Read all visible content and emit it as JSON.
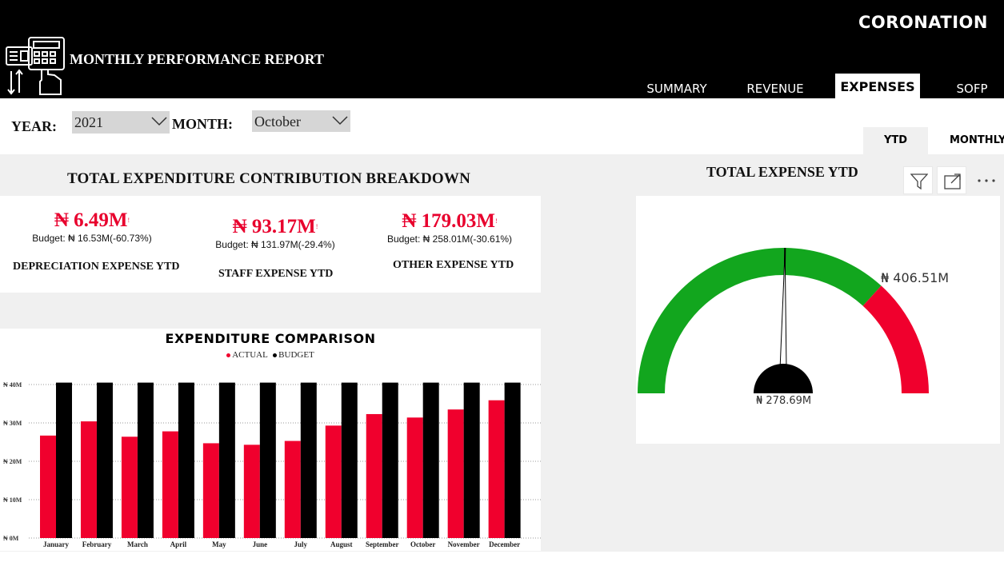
{
  "header": {
    "brand": "CORONATION",
    "report_title": "MONTHLY PERFORMANCE REPORT",
    "logo_icon": "calculator-hand-icon",
    "tabs": [
      {
        "label": "SUMMARY",
        "active": false
      },
      {
        "label": "REVENUE",
        "active": false
      },
      {
        "label": "EXPENSES",
        "active": true
      },
      {
        "label": "SOFP",
        "active": false
      }
    ]
  },
  "filters": {
    "year_label": "YEAR:",
    "year_value": "2021",
    "month_label": "MONTH:",
    "month_value": "October"
  },
  "period_toggle": {
    "ytd_label": "YTD",
    "monthly_label": "MONTHLY",
    "active": "YTD"
  },
  "breakdown": {
    "title": "TOTAL EXPENDITURE CONTRIBUTION BREAKDOWN",
    "kpis": [
      {
        "value": "₦ 6.49M",
        "budget": "Budget: ₦ 16.53M(-60.73%)",
        "label": "DEPRECIATION EXPENSE YTD"
      },
      {
        "value": "₦ 93.17M",
        "budget": "Budget: ₦ 131.97M(-29.4%)",
        "label": "STAFF EXPENSE YTD"
      },
      {
        "value": "₦ 179.03M",
        "budget": "Budget: ₦ 258.01M(-30.61%)",
        "label": "OTHER EXPENSE YTD"
      }
    ],
    "kpi_marker": "!"
  },
  "gauge": {
    "title": "TOTAL EXPENSE YTD",
    "value_label": "₦ 278.69M",
    "target_label": "₦ 406.51M",
    "value": 278.69,
    "target": 406.51,
    "min": 0,
    "max": 553.0,
    "colors": {
      "good": "#12a61e",
      "bad": "#f0002d",
      "needle": "#000000"
    }
  },
  "toolbar": {
    "filter_icon": "filter-icon",
    "focus_icon": "focus-mode-icon",
    "more_icon": "more-options-icon"
  },
  "chart_data": {
    "type": "bar",
    "title": "EXPENDITURE COMPARISON",
    "legend": [
      "ACTUAL",
      "BUDGET"
    ],
    "categories": [
      "January",
      "February",
      "March",
      "April",
      "May",
      "June",
      "July",
      "August",
      "September",
      "October",
      "November",
      "December"
    ],
    "series": [
      {
        "name": "ACTUAL",
        "color": "#f0002d",
        "values": [
          26.7,
          30.4,
          26.4,
          27.8,
          24.7,
          24.3,
          25.3,
          29.3,
          32.3,
          31.4,
          33.5,
          35.9
        ]
      },
      {
        "name": "BUDGET",
        "color": "#000000",
        "values": [
          40.5,
          40.5,
          40.5,
          40.5,
          40.5,
          40.5,
          40.5,
          40.5,
          40.5,
          40.5,
          40.5,
          40.5
        ]
      }
    ],
    "yticks": [
      "₦ 0M",
      "₦ 10M",
      "₦ 20M",
      "₦ 30M",
      "₦ 40M"
    ],
    "ylim": [
      0,
      40
    ],
    "grid": true,
    "legend_position": "top-center"
  }
}
